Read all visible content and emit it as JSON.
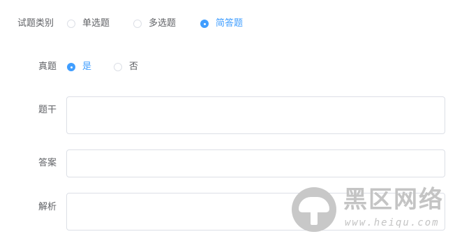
{
  "question_type": {
    "label": "试题类别",
    "options": [
      {
        "label": "单选题",
        "checked": false
      },
      {
        "label": "多选题",
        "checked": false
      },
      {
        "label": "简答题",
        "checked": true
      }
    ]
  },
  "is_real": {
    "label": "真题",
    "options": [
      {
        "label": "是",
        "checked": true
      },
      {
        "label": "否",
        "checked": false
      }
    ]
  },
  "stem": {
    "label": "题干",
    "value": ""
  },
  "answer": {
    "label": "答案",
    "value": ""
  },
  "analysis": {
    "label": "解析",
    "value": ""
  },
  "colors": {
    "accent": "#409eff",
    "border": "#dcdfe6",
    "text": "#606266"
  },
  "watermark": {
    "title": "黑区网络",
    "url": "www.heiqu.com",
    "icon": "mushroom-logo-icon"
  }
}
